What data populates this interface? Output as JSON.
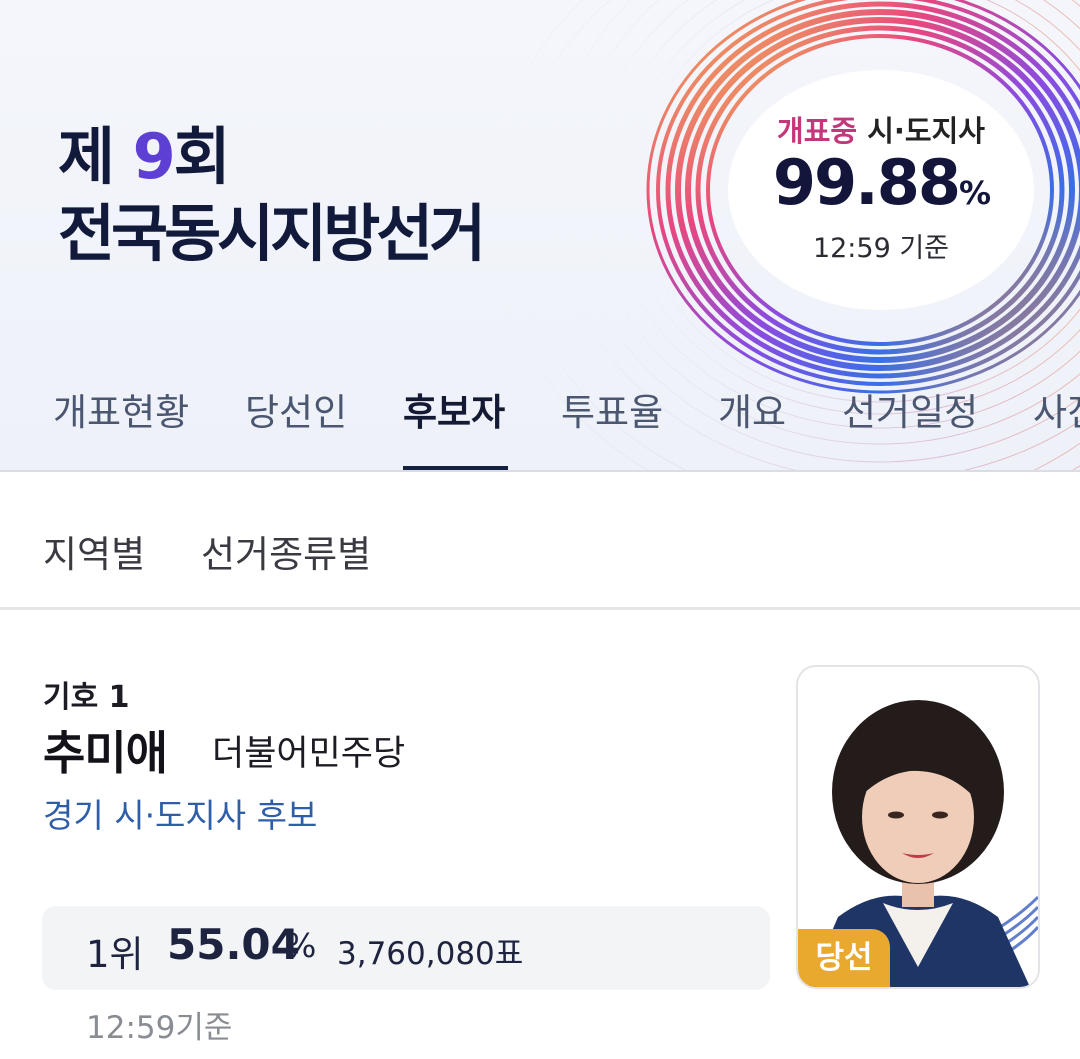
{
  "banner": {
    "title_prefix": "제 ",
    "title_number": "9",
    "title_suffix": "회",
    "title_line2": "전국동시지방선거"
  },
  "count": {
    "status_live": "개표중",
    "status_type": "시·도지사",
    "value": "99.88",
    "unit": "%",
    "time": "12:59 기준"
  },
  "tabs": [
    {
      "label": "개표현황"
    },
    {
      "label": "당선인"
    },
    {
      "label": "후보자",
      "active": true
    },
    {
      "label": "투표율"
    },
    {
      "label": "개요"
    },
    {
      "label": "선거일정"
    },
    {
      "label": "사진"
    }
  ],
  "subtabs": [
    {
      "label": "지역별"
    },
    {
      "label": "선거종류별"
    }
  ],
  "candidate": {
    "giho": "기호 1",
    "name": "추미애",
    "party": "더불어민주당",
    "region": "경기 시·도지사 후보",
    "rank": "1위",
    "rate": "55.04",
    "rate_unit": "%",
    "votes": "3,760,080표",
    "basis": "12:59기준",
    "badge": "당선"
  },
  "colors": {
    "accent_live": "#c2387a",
    "title_navy": "#111a3a",
    "region_blue": "#2f5ea8",
    "badge_gold": "#e8a92e"
  }
}
